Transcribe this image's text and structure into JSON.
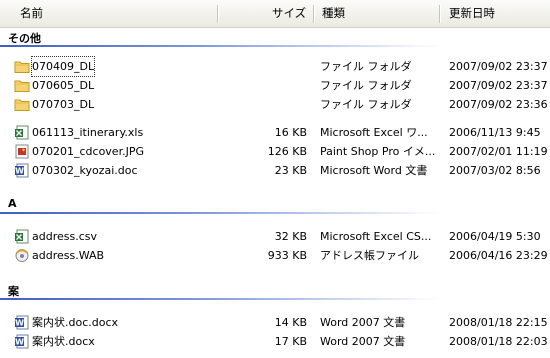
{
  "columns": {
    "name": "名前",
    "size": "サイズ",
    "type": "種類",
    "date": "更新日時"
  },
  "groups": [
    {
      "label": "その他",
      "items": [
        {
          "name": "070409_DL",
          "size": "",
          "type": "ファイル フォルダ",
          "date": "2007/09/02 23:37",
          "icon": "folder-icon"
        },
        {
          "name": "070605_DL",
          "size": "",
          "type": "ファイル フォルダ",
          "date": "2007/09/02 23:37",
          "icon": "folder-icon"
        },
        {
          "name": "070703_DL",
          "size": "",
          "type": "ファイル フォルダ",
          "date": "2007/09/02 23:36",
          "icon": "folder-icon"
        },
        {
          "name": "061113_itinerary.xls",
          "size": "16 KB",
          "type": "Microsoft Excel ワ...",
          "date": "2006/11/13 9:45",
          "icon": "excel-icon"
        },
        {
          "name": "070201_cdcover.JPG",
          "size": "126 KB",
          "type": "Paint Shop Pro イメ...",
          "date": "2007/02/01 11:19",
          "icon": "image-icon"
        },
        {
          "name": "070302_kyozai.doc",
          "size": "23 KB",
          "type": "Microsoft Word 文書",
          "date": "2007/03/02 8:56",
          "icon": "word-icon"
        }
      ]
    },
    {
      "label": "A",
      "items": [
        {
          "name": "address.csv",
          "size": "32 KB",
          "type": "Microsoft Excel CS...",
          "date": "2006/04/19 5:30",
          "icon": "excel-icon"
        },
        {
          "name": "address.WAB",
          "size": "933 KB",
          "type": "アドレス帳ファイル",
          "date": "2006/04/16 23:29",
          "icon": "address-book-icon"
        }
      ]
    },
    {
      "label": "案",
      "items": [
        {
          "name": "案内状.doc.docx",
          "size": "14 KB",
          "type": "Word 2007 文書",
          "date": "2008/01/18 22:15",
          "icon": "word-icon"
        },
        {
          "name": "案内状.docx",
          "size": "17 KB",
          "type": "Word 2007 文書",
          "date": "2008/01/18 22:03",
          "icon": "word-icon"
        }
      ]
    }
  ]
}
